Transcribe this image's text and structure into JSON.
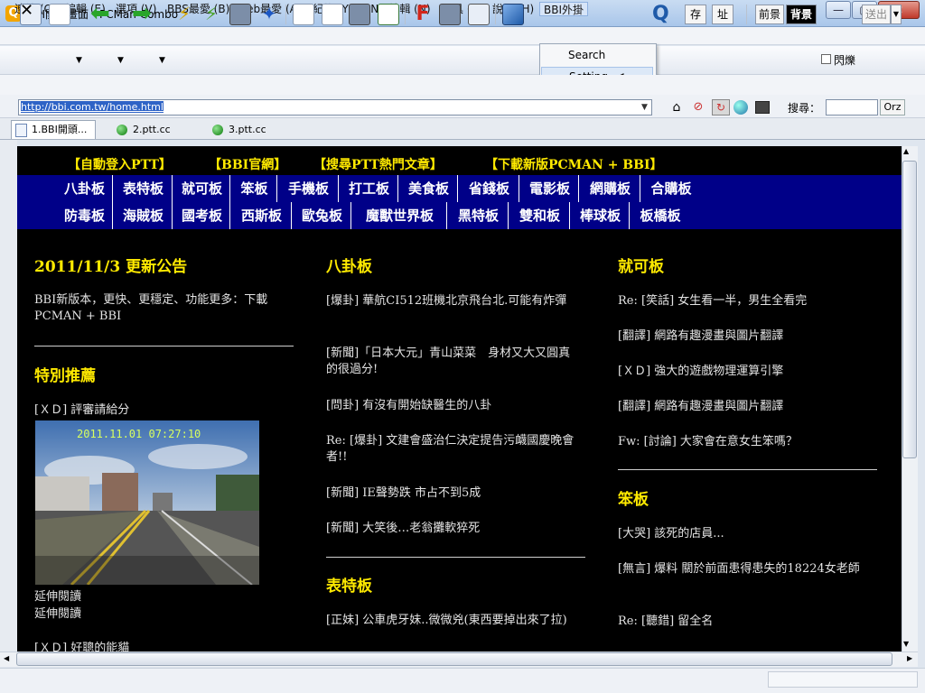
{
  "window": {
    "title": "BBI開頭畫面 - PCMan Combo"
  },
  "menu": [
    "連線 (C)",
    "編輯 (E)",
    "選項 (V)",
    "BBS最愛 (B)",
    "Web最愛 (A)",
    "紀錄 (Y)",
    "ANSI編輯 (N)",
    "工具 (T)",
    "說明 (H)",
    "BBI外掛"
  ],
  "dropdown": [
    "Search",
    "Setting"
  ],
  "toolbar": {
    "save": "存",
    "address": "址",
    "fg": "前景",
    "bg": "背景",
    "blink": "閃爍",
    "send": "送出"
  },
  "address_bar": {
    "url": "http://bbi.com.tw/home.html",
    "search_label": "搜尋：",
    "search_engine": "Orz"
  },
  "tabs": [
    "1.BBI開頭...",
    "2.ptt.cc",
    "3.ptt.cc"
  ],
  "content": {
    "top_links": [
      "【自動登入PTT】",
      "【BBI官網】",
      "【搜尋PTT熱門文章】",
      "【下載新版PCMAN + BBI】"
    ],
    "boards_row1": [
      "八卦板",
      "表特板",
      "就可板",
      "笨板",
      "手機板",
      "打工板",
      "美食板",
      "省錢板",
      "電影板",
      "網購板",
      "合購板"
    ],
    "boards_row2": [
      "防毒板",
      "海賊板",
      "國考板",
      "西斯板",
      "歐兔板",
      "魔獸世界板",
      "黑特板",
      "雙和板",
      "棒球板",
      "板橋板"
    ],
    "col1": {
      "title": "2011/11/3 更新公告",
      "notice": "BBI新版本，更快、更穩定、功能更多：下載PCMAN + BBI",
      "featured_title": "特別推薦",
      "featured_item": "[ＸＤ] 評審請給分",
      "photo_time": "2011.11.01 07:27:10",
      "read_more_1": "延伸閱讀",
      "read_more_2": "延伸閱讀",
      "bottom": "[ＸＤ] 好聰的能貓"
    },
    "col2": {
      "title": "八卦板",
      "posts": [
        "[爆卦] 華航CI512班機北京飛台北.可能有炸彈",
        "[新聞]「日本大元」青山菜菜　身材又大又圓真的很過分!",
        "[問卦] 有沒有開始缺醫生的八卦",
        "Re: [爆卦] 文建會盛治仁決定提告污衊國慶晚會者!!",
        "[新聞] IE聲勢跌 市占不到5成",
        "[新聞] 大笑後…老翁攤軟猝死"
      ],
      "title2": "表特板",
      "posts2": [
        "[正妹] 公車虎牙妹..微微兇(東西要掉出來了拉)"
      ]
    },
    "col3": {
      "title": "就可板",
      "posts": [
        "Re: [笑話] 女生看一半，男生全看完",
        "[翻譯] 網路有趣漫畫與圖片翻譯",
        "[ＸＤ] 強大的遊戲物理運算引擎",
        "[翻譯] 網路有趣漫畫與圖片翻譯",
        "Fw: [討論] 大家會在意女生笨嗎？"
      ],
      "title2": "笨板",
      "posts2": [
        "[大哭] 該死的店員...",
        "[無言] 爆料 關於前面患得患失的18224女老師",
        "Re: [聽錯] 留全名"
      ]
    }
  },
  "colors": {
    "content_bg": "#000000",
    "link_yellow": "#ffea00",
    "nav_blue": "#000088"
  }
}
